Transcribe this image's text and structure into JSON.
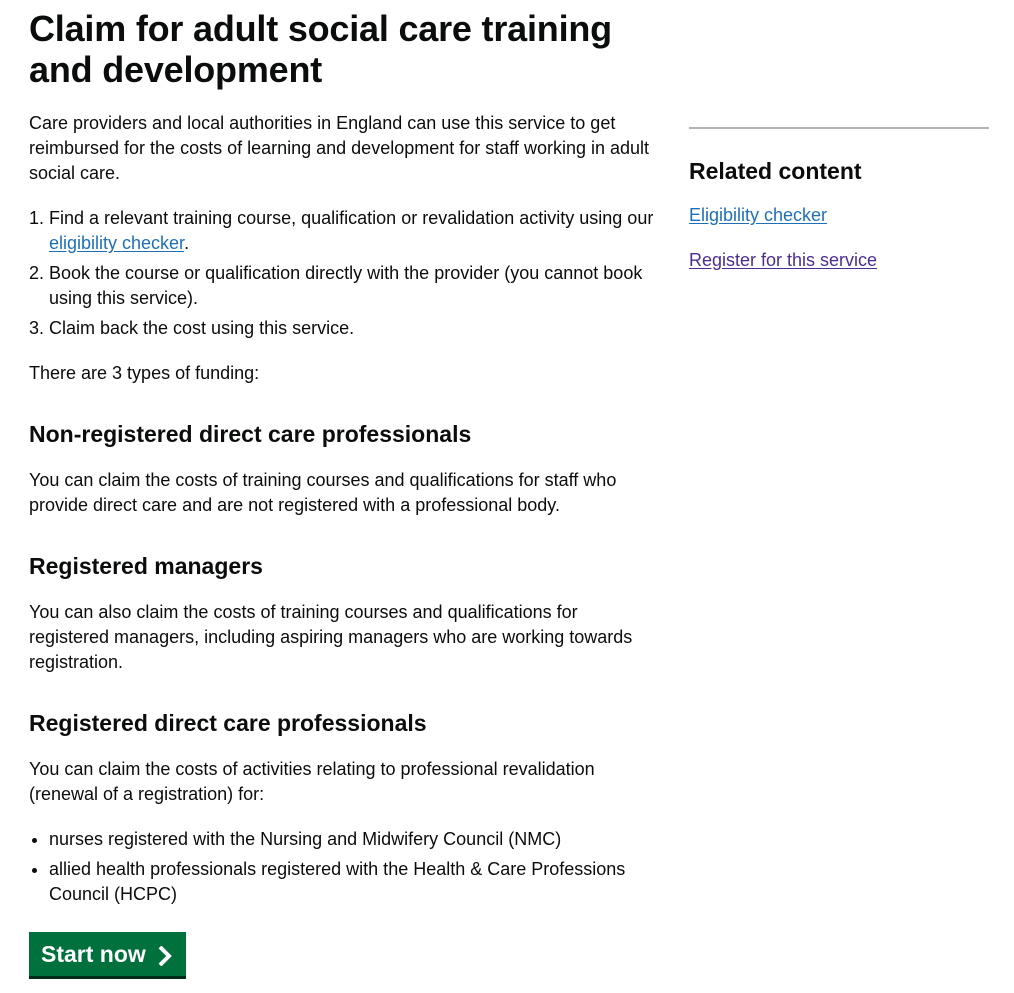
{
  "page": {
    "title": "Claim for adult social care training and development",
    "intro": "Care providers and local authorities in England can use this service to get reimbursed for the costs of learning and development for staff working in adult social care.",
    "steps": {
      "step1_text": "Find a relevant training course, qualification or revalidation activity using our ",
      "step1_link": "eligibility checker",
      "step1_end": ".",
      "step2": "Book the course or qualification directly with the provider (you cannot book using this service).",
      "step3": "Claim back the cost using this service."
    },
    "funding_intro": "There are 3 types of funding:",
    "sections": [
      {
        "heading": "Non-registered direct care professionals",
        "body": "You can claim the costs of training courses and qualifications for staff who provide direct care and are not registered with a professional body."
      },
      {
        "heading": "Registered managers",
        "body": "You can also claim the costs of training courses and qualifications for registered managers, including aspiring managers who are working towards registration."
      },
      {
        "heading": "Registered direct care professionals",
        "body": "You can claim the costs of activities relating to professional revalidation (renewal of a registration) for:",
        "bullets": [
          "nurses registered with the Nursing and Midwifery Council (NMC)",
          "allied health professionals registered with the Health & Care Professions Council (HCPC)"
        ]
      }
    ],
    "start_button": "Start now"
  },
  "sidebar": {
    "heading": "Related content",
    "links": [
      "Eligibility checker",
      "Register for this service"
    ]
  },
  "colors": {
    "text": "#0b0c0c",
    "link": "#1d70b8",
    "visited_link": "#4c2c92",
    "button": "#00703c",
    "button_shadow": "#002d18",
    "divider": "#b1b4b6"
  },
  "icons": {
    "start_button": "chevron-right-icon"
  }
}
